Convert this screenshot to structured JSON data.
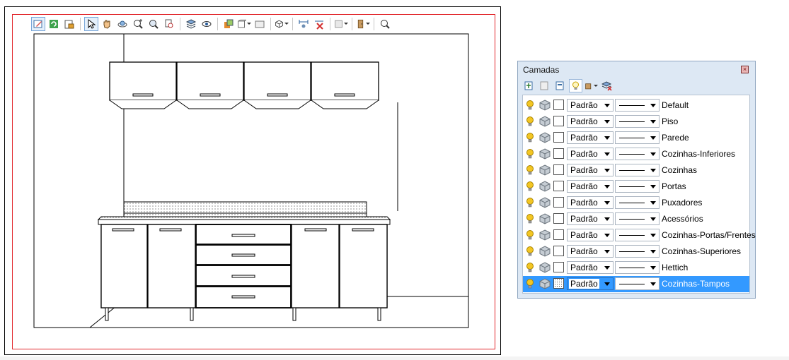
{
  "drawing_view": {
    "toolbar_buttons": [
      {
        "name": "edit-properties-icon"
      },
      {
        "name": "refresh-icon"
      },
      {
        "name": "lock-layout-icon"
      },
      {
        "name": "select-pointer-icon"
      },
      {
        "name": "pan-hand-icon"
      },
      {
        "name": "orbit-icon"
      },
      {
        "name": "zoom-in-icon"
      },
      {
        "name": "zoom-window-icon"
      },
      {
        "name": "zoom-previous-icon"
      },
      {
        "name": "layers-icon"
      },
      {
        "name": "eye-view-icon"
      },
      {
        "name": "render-style-icon"
      },
      {
        "name": "viewport-icon"
      },
      {
        "name": "hide-frame-icon"
      },
      {
        "name": "3d-box-view-icon"
      },
      {
        "name": "dimension-icon"
      },
      {
        "name": "delete-dimension-icon"
      },
      {
        "name": "background-color-icon"
      },
      {
        "name": "door-icon"
      },
      {
        "name": "zoom-search-icon"
      }
    ]
  },
  "layers_panel": {
    "title": "Camadas",
    "close_label": "x",
    "colors": {
      "selected": "#3399ff",
      "panel_bg": "#dde8f4",
      "bulb": "#f3c623"
    },
    "layers": [
      {
        "name": "Default",
        "fill": "Padrão",
        "selected": false
      },
      {
        "name": "Piso",
        "fill": "Padrão",
        "selected": false
      },
      {
        "name": "Parede",
        "fill": "Padrão",
        "selected": false
      },
      {
        "name": "Cozinhas-Inferiores",
        "fill": "Padrão",
        "selected": false
      },
      {
        "name": "Cozinhas",
        "fill": "Padrão",
        "selected": false
      },
      {
        "name": "Portas",
        "fill": "Padrão",
        "selected": false
      },
      {
        "name": "Puxadores",
        "fill": "Padrão",
        "selected": false
      },
      {
        "name": "Acessórios",
        "fill": "Padrão",
        "selected": false
      },
      {
        "name": "Cozinhas-Portas/Frentes",
        "fill": "Padrão",
        "selected": false
      },
      {
        "name": "Cozinhas-Superiores",
        "fill": "Padrão",
        "selected": false
      },
      {
        "name": "Hettich",
        "fill": "Padrão",
        "selected": false
      },
      {
        "name": "Cozinhas-Tampos",
        "fill": "Padrão",
        "selected": true
      }
    ]
  }
}
